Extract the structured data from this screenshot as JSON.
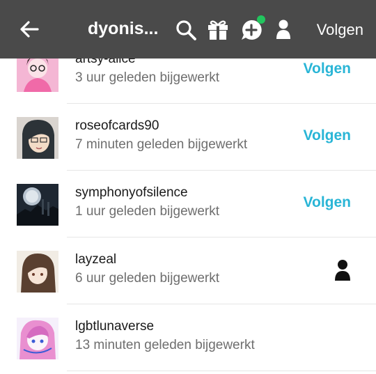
{
  "header": {
    "title": "dyonis...",
    "follow_label": "Volgen",
    "icons": [
      "back-arrow-icon",
      "search-icon",
      "gift-icon",
      "chat-add-icon",
      "account-icon"
    ],
    "notification_color": "#22c55e"
  },
  "list": {
    "follow_label": "Volgen",
    "accent_color": "#29b5d6",
    "rows": [
      {
        "username": "artsy-alice",
        "updated": "3 uur geleden bijgewerkt",
        "action": "follow"
      },
      {
        "username": "roseofcards90",
        "updated": "7 minuten geleden bijgewerkt",
        "action": "follow"
      },
      {
        "username": "symphonyofsilence",
        "updated": "1 uur geleden bijgewerkt",
        "action": "follow"
      },
      {
        "username": "layzeal",
        "updated": "6 uur geleden bijgewerkt",
        "action": "following-icon"
      },
      {
        "username": "lgbtlunaverse",
        "updated": "13 minuten geleden bijgewerkt",
        "action": "none"
      }
    ]
  }
}
